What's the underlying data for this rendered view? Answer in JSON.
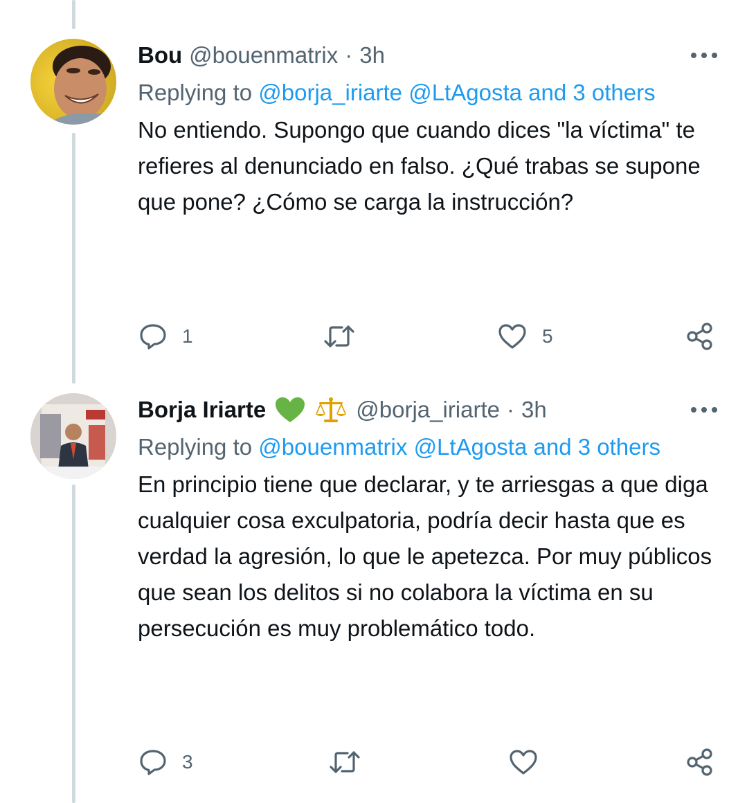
{
  "tweets": [
    {
      "name": "Bou",
      "handle": "@bouenmatrix",
      "separator": "·",
      "time": "3h",
      "replying_prefix": "Replying to",
      "replying_users": [
        "@borja_iriarte",
        "@LtAgosta"
      ],
      "replying_others": "and 3 others",
      "text": "No entiendo. Supongo que cuando dices \"la víctima\" te refieres al denunciado en falso. ¿Qué trabas se supone que pone? ¿Cómo se carga la instrucción?",
      "reply_count": "1",
      "retweet_count": "",
      "like_count": "5"
    },
    {
      "name": "Borja Iriarte",
      "name_emojis": [
        "green-heart",
        "scales"
      ],
      "handle": "@borja_iriarte",
      "separator": "·",
      "time": "3h",
      "replying_prefix": "Replying to",
      "replying_users": [
        "@bouenmatrix",
        "@LtAgosta"
      ],
      "replying_others": "and 3 others",
      "text": "En principio tiene que declarar, y te arriesgas a que diga cualquier cosa exculpatoria, podría decir hasta que es verdad la agresión, lo que le apetezca. Por muy públicos que sean los delitos si no colabora la víctima en su persecución es muy problemático todo.",
      "reply_count": "3",
      "retweet_count": "",
      "like_count": ""
    }
  ],
  "colors": {
    "link": "#1d9bf0",
    "secondary": "#536471",
    "primary_text": "#0f1419",
    "thread_line": "#cfd9de",
    "heart_emoji": "#67b346"
  },
  "icons": [
    "more-icon",
    "reply-icon",
    "retweet-icon",
    "like-icon",
    "share-icon"
  ]
}
